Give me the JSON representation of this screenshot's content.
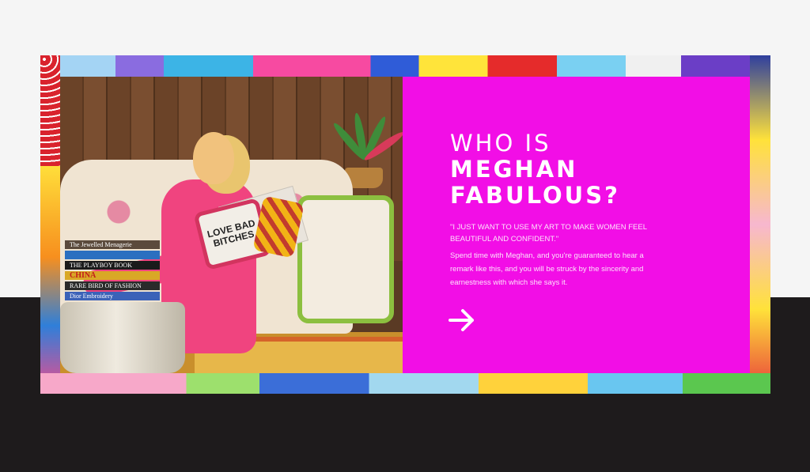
{
  "hero": {
    "heading_line1": "WHO IS",
    "heading_line2": "MEGHAN",
    "heading_line3": "FABULOUS?",
    "quote": "\"I JUST WANT TO USE MY ART TO MAKE WOMEN FEEL BEAUTIFUL AND CONFIDENT.\"",
    "body": "Spend time with Meghan, and you're guaranteed to hear a remark like this, and you will be struck by the sincerity and earnestness with which she says it.",
    "arrow_icon": "arrow-right-icon"
  },
  "photo": {
    "pillow_text": "LOVE BAD BITCHES",
    "book_titles": [
      "The Jewelled Menagerie",
      "THE PLAYBOY BOOK",
      "CHINA",
      "RARE BIRD OF FASHION",
      "Dior Embroidery"
    ]
  },
  "colors": {
    "panel": "#f20ee6",
    "page_top": "#f5f5f5",
    "page_bottom": "#1e1b1c"
  }
}
